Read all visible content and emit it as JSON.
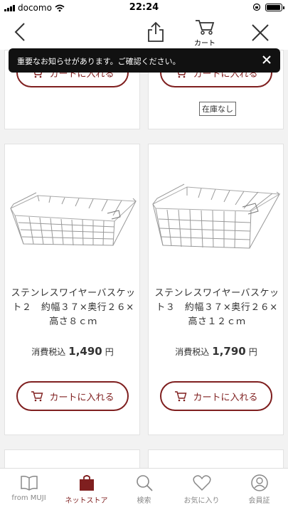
{
  "status_bar": {
    "carrier": "docomo",
    "time": "22:24"
  },
  "nav": {
    "cart_label": "カート"
  },
  "toast": {
    "message": "重要なお知らせがあります。ご確認ください。"
  },
  "products_top": [
    {
      "button_label": "カートに入れる"
    },
    {
      "button_label": "カートに入れる",
      "stock_label": "在庫なし"
    }
  ],
  "products": [
    {
      "title_line1": "ステンレスワイヤーバスケッ",
      "title_line2": "ト２　約幅３７×奥行２６×",
      "title_line3": "高さ８ｃｍ",
      "price_prefix": "消費税込",
      "price": "1,490",
      "currency": "円",
      "button_label": "カートに入れる"
    },
    {
      "title_line1": "ステンレスワイヤーバスケッ",
      "title_line2": "ト３　約幅３７×奥行２６×",
      "title_line3": "高さ１２ｃｍ",
      "price_prefix": "消費税込",
      "price": "1,790",
      "currency": "円",
      "button_label": "カートに入れる"
    }
  ],
  "tabs": [
    {
      "label": "from MUJI",
      "icon": "book-icon"
    },
    {
      "label": "ネットストア",
      "icon": "shopping-bag-icon",
      "active": true
    },
    {
      "label": "検索",
      "icon": "search-icon"
    },
    {
      "label": "お気に入り",
      "icon": "heart-icon"
    },
    {
      "label": "会員証",
      "icon": "member-card-icon"
    }
  ],
  "colors": {
    "accent": "#7f1f1f",
    "toast_bg": "#111111",
    "background": "#f2f2f2"
  }
}
